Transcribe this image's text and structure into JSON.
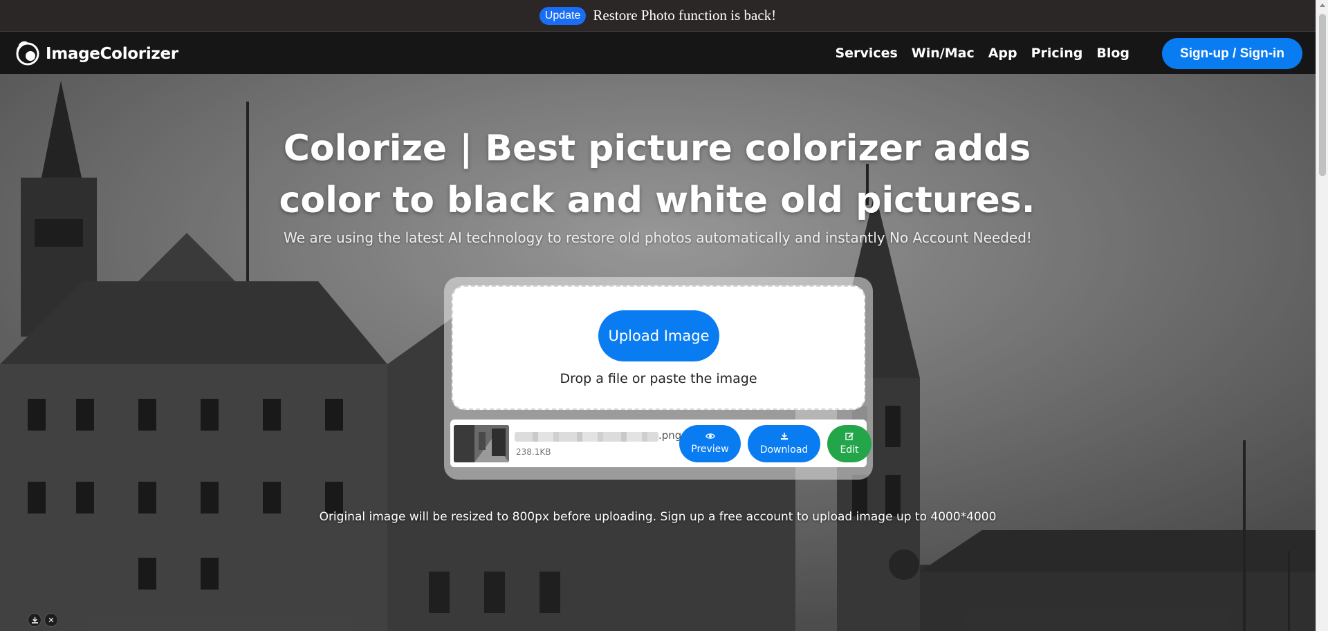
{
  "announcement": {
    "badge": "Update",
    "text": "Restore Photo function is back!"
  },
  "brand": {
    "name": "ImageColorizer"
  },
  "nav": {
    "items": [
      {
        "label": "Services"
      },
      {
        "label": "Win/Mac"
      },
      {
        "label": "App"
      },
      {
        "label": "Pricing"
      },
      {
        "label": "Blog"
      }
    ],
    "signin_label": "Sign-up / Sign-in"
  },
  "hero": {
    "title": "Colorize | Best picture colorizer adds color to black and white old pictures.",
    "subtitle": "We are using the latest AI technology to restore old photos automatically and instantly No Account Needed!"
  },
  "uploader": {
    "upload_label": "Upload Image",
    "drop_hint": "Drop a file or paste the image",
    "file": {
      "extension": ".png",
      "size": "238.1KB"
    },
    "actions": {
      "preview": "Preview",
      "download": "Download",
      "edit": "Edit"
    }
  },
  "footer_note": "Original image will be resized to 800px before uploading. Sign up a free account to upload image up to 4000*4000",
  "colors": {
    "accent": "#0a7cf2",
    "edit": "#23a54a",
    "badge": "#1a6ef5",
    "nav_bg": "#161616"
  },
  "icons": {
    "logo": "colorizer-logo-icon",
    "preview": "eye-icon",
    "download": "download-icon",
    "edit": "edit-icon",
    "mini_download": "download-icon",
    "mini_close": "close-icon"
  }
}
